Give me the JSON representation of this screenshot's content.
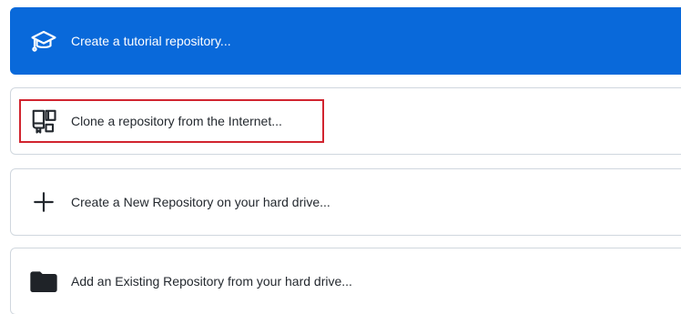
{
  "options": [
    {
      "label": "Create a tutorial repository...",
      "icon": "mortarboard-icon"
    },
    {
      "label": "Clone a repository from the Internet...",
      "icon": "repo-clone-icon"
    },
    {
      "label": "Create a New Repository on your hard drive...",
      "icon": "plus-icon"
    },
    {
      "label": "Add an Existing Repository from your hard drive...",
      "icon": "folder-icon"
    }
  ],
  "colors": {
    "primary": "#0969da",
    "border": "#d0d7de",
    "text": "#24292f",
    "highlight": "#d1242f"
  }
}
